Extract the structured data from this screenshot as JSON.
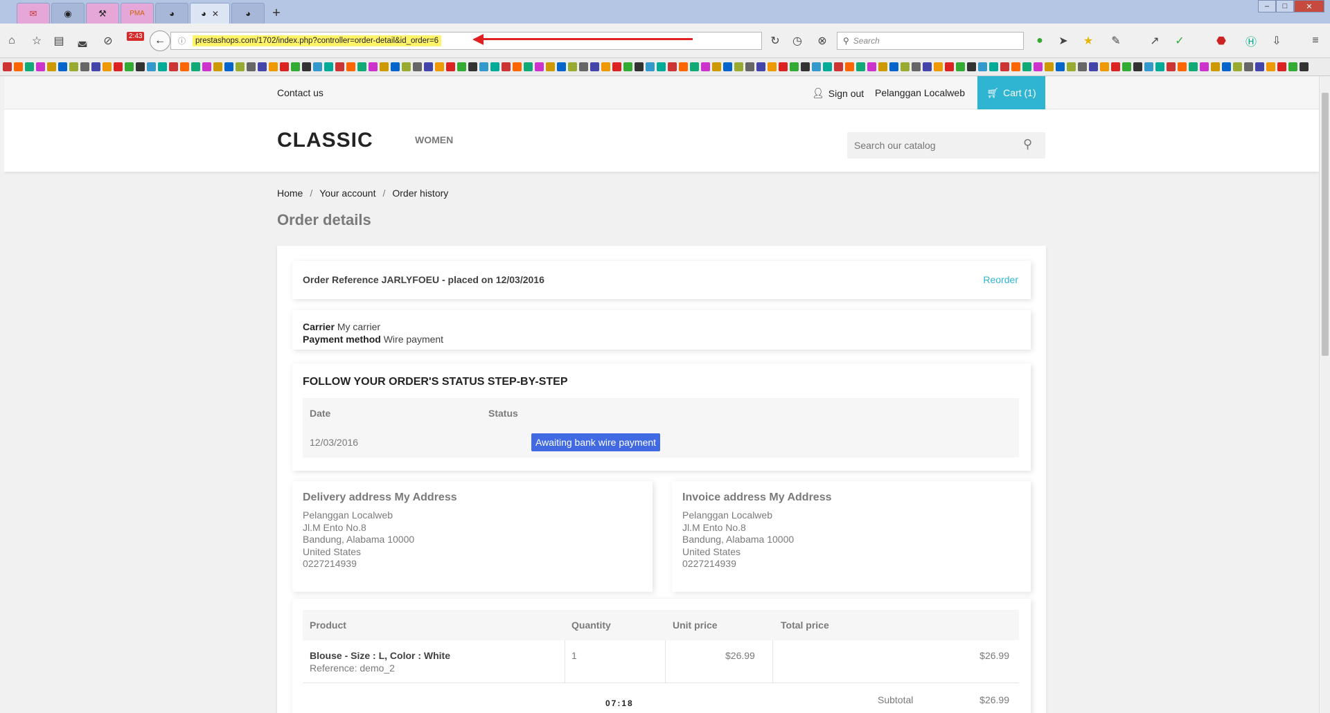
{
  "browser": {
    "tabs": [
      {
        "icon": "gmail-icon"
      },
      {
        "icon": "globe-icon"
      },
      {
        "icon": "tool-icon"
      },
      {
        "icon": "phpmyadmin-icon"
      },
      {
        "icon": "prestashop-icon"
      },
      {
        "icon": "prestashop-icon",
        "active": true,
        "close": "✕"
      },
      {
        "icon": "prestashop-icon"
      }
    ],
    "new_tab": "+",
    "badge": "2:43",
    "url": "prestashops.com/1702/index.php?controller=order-detail&id_order=6",
    "search_placeholder": "Search",
    "window_controls": [
      "–",
      "□",
      "✕"
    ]
  },
  "site": {
    "contact": "Contact us",
    "sign_out": "Sign out",
    "username": "Pelanggan Localweb",
    "cart": "Cart (1)",
    "logo": "CLASSIC",
    "menu_women": "WOMEN",
    "search_placeholder": "Search our catalog"
  },
  "breadcrumb": [
    "Home",
    "Your account",
    "Order history"
  ],
  "breadcrumb_sep": "/",
  "page_title": "Order details",
  "order": {
    "reference_line": "Order Reference JARLYFOEU - placed on 12/03/2016",
    "reorder": "Reorder",
    "carrier_label": "Carrier",
    "carrier_value": "My carrier",
    "payment_label": "Payment method",
    "payment_value": "Wire payment"
  },
  "status": {
    "title": "FOLLOW YOUR ORDER'S STATUS STEP-BY-STEP",
    "col_date": "Date",
    "col_status": "Status",
    "date": "12/03/2016",
    "status": "Awaiting bank wire payment"
  },
  "delivery": {
    "title": "Delivery address My Address",
    "lines": [
      "Pelanggan Localweb",
      "Jl.M Ento No.8",
      "Bandung, Alabama 10000",
      "United States",
      "0227214939"
    ]
  },
  "invoice": {
    "title": "Invoice address My Address",
    "lines": [
      "Pelanggan Localweb",
      "Jl.M Ento No.8",
      "Bandung, Alabama 10000",
      "United States",
      "0227214939"
    ]
  },
  "products": {
    "headers": [
      "Product",
      "Quantity",
      "Unit price",
      "Total price"
    ],
    "rows": [
      {
        "name": "Blouse - Size : L, Color : White",
        "reference": "Reference: demo_2",
        "quantity": "1",
        "unit_price": "$26.99",
        "total_price": "$26.99"
      }
    ],
    "subtotal_label": "Subtotal",
    "subtotal_value": "$26.99"
  },
  "clock": "07:18",
  "colors": {
    "accent": "#2fb5d2",
    "status_badge": "#4169e1"
  }
}
